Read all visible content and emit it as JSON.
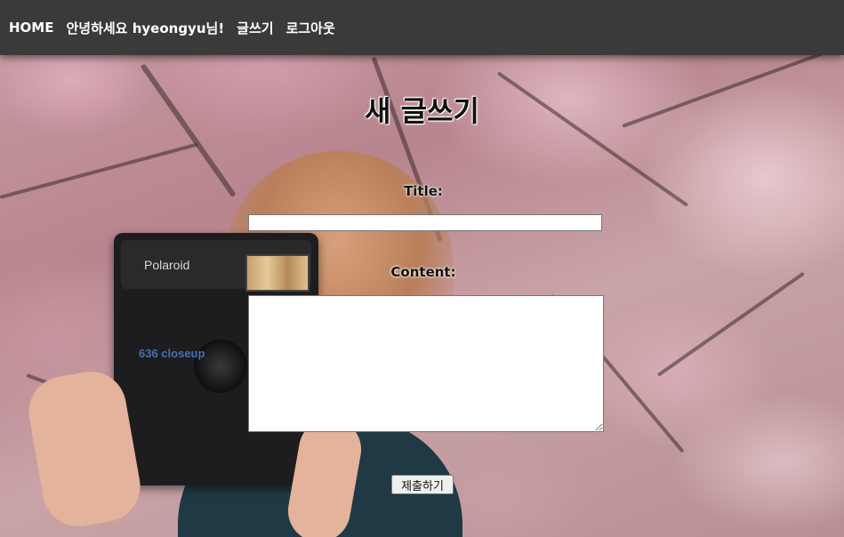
{
  "navbar": {
    "home_label": "HOME",
    "greeting": "안녕하세요 hyeongyu님!",
    "write_label": "글쓰기",
    "logout_label": "로그아웃"
  },
  "form": {
    "page_title": "새 글쓰기",
    "title_label": "Title:",
    "title_value": "",
    "content_label": "Content:",
    "content_value": "",
    "submit_label": "제출하기"
  },
  "background": {
    "camera_brand": "Polaroid",
    "camera_model": "636 closeup"
  },
  "colors": {
    "navbar_bg": "#3a3a3a",
    "nav_text": "#ffffff"
  }
}
